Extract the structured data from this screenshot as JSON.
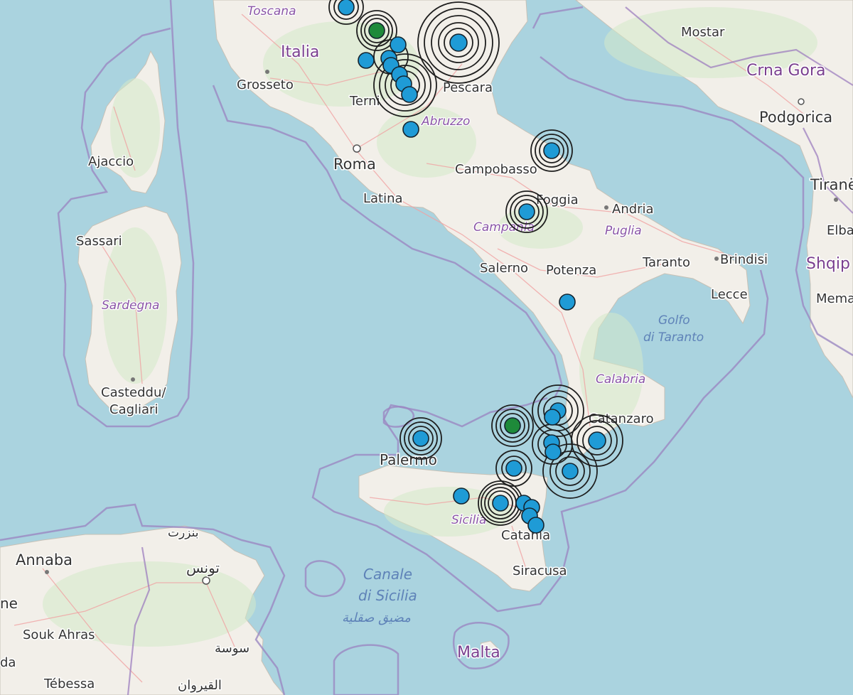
{
  "map": {
    "labels": {
      "toscana": "Toscana",
      "italia": "Italia",
      "grosseto": "Grosseto",
      "terni": "Terni",
      "pescara": "Pescara",
      "abruzzo": "Abruzzo",
      "roma": "Roma",
      "latina": "Latina",
      "campobasso": "Campobasso",
      "foggia": "Foggia",
      "andria": "Andria",
      "puglia": "Puglia",
      "campania": "Campania",
      "salerno": "Salerno",
      "potenza": "Potenza",
      "taranto": "Taranto",
      "brindisi": "Brindisi",
      "lecce": "Lecce",
      "golfo_line1": "Golfo",
      "golfo_line2": "di Taranto",
      "calabria": "Calabria",
      "catanzaro": "Catanzaro",
      "palermo": "Palermo",
      "sicilia": "Sicilia",
      "catania": "Catania",
      "siracusa": "Siracusa",
      "canale_line1": "Canale",
      "canale_line2": "di Sicilia",
      "canale_arabic": "مضيق صقلية",
      "malta": "Malta",
      "ajaccio": "Ajaccio",
      "sassari": "Sassari",
      "sardegna": "Sardegna",
      "casteddu": "Casteddu/",
      "cagliari": "Cagliari",
      "mostar": "Mostar",
      "crna_gora": "Crna Gora",
      "podgorica": "Podgorica",
      "tirana": "Tiranë",
      "elbasan": "Elba",
      "shqiperia": "Shqip",
      "memaliaj": "Mema",
      "annaba": "Annaba",
      "bizerte_ar": "بنزرت",
      "tunis_ar": "تونس",
      "souk_ahras": "Souk Ahras",
      "sousse_ar": "سوسة",
      "kairouan_ar": "القيروان",
      "tebessa": "Tébessa",
      "partial_ne": "ne",
      "partial_da": "da"
    },
    "colors": {
      "sea": "#aad3df",
      "land": "#f2efe9",
      "event_blue": "#1f9bd6",
      "event_green": "#1e8a3a",
      "ring": "#1e1e1e",
      "border": "#9d7fbf"
    }
  }
}
